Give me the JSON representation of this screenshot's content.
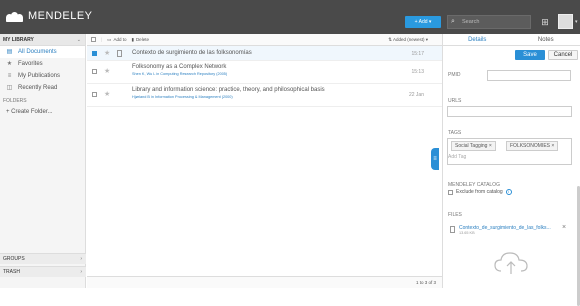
{
  "app": {
    "name": "MENDELEY"
  },
  "topbar": {
    "add_label": "+ Add ▾",
    "search_placeholder": "Search"
  },
  "sidebar": {
    "header": "MY LIBRARY",
    "items": [
      {
        "label": "All Documents",
        "icon": "documents-icon",
        "active": true
      },
      {
        "label": "Favorites",
        "icon": "star-icon"
      },
      {
        "label": "My Publications",
        "icon": "publications-icon"
      },
      {
        "label": "Recently Read",
        "icon": "book-icon"
      }
    ],
    "folders_label": "FOLDERS",
    "create_folder": "+  Create Folder...",
    "groups": "GROUPS",
    "trash": "TRASH"
  },
  "toolbar": {
    "add_to": "Add to",
    "delete": "Delete",
    "sort": "Added (newest) ▾"
  },
  "documents": [
    {
      "title": "Contexto de surgimiento de las folksonomías",
      "authors": "",
      "date": "15:17"
    },
    {
      "title": "Folksonomy as a Complex Network",
      "authors": "Shen K, Wu L in Computing Research Repository (2005)",
      "date": "15:13"
    },
    {
      "title": "Library and information science: practice, theory, and philosophical basis",
      "authors": "Hjørland B in Information Processing & Management (2000)",
      "date": "22 Jan"
    }
  ],
  "pager": "1 to 3 of 3",
  "details": {
    "tabs": [
      "Details",
      "Notes"
    ],
    "save": "Save",
    "cancel": "Cancel",
    "pmid_label": "PMID",
    "urls_label": "URLS",
    "tags_label": "TAGS",
    "tags": [
      "Social Tagging ×",
      "FOLKSONOMIES ×"
    ],
    "tag_placeholder": "Add Tag",
    "catalog_label": "MENDELEY CATALOG",
    "exclude_label": "Exclude from catalog",
    "files_label": "FILES",
    "file_name": "Contexto_de_surgimiento_de_las_folks...",
    "file_size": "13.65 KB"
  },
  "colors": {
    "topbar": "#4a4a4a",
    "accent": "#2a8fd6"
  }
}
